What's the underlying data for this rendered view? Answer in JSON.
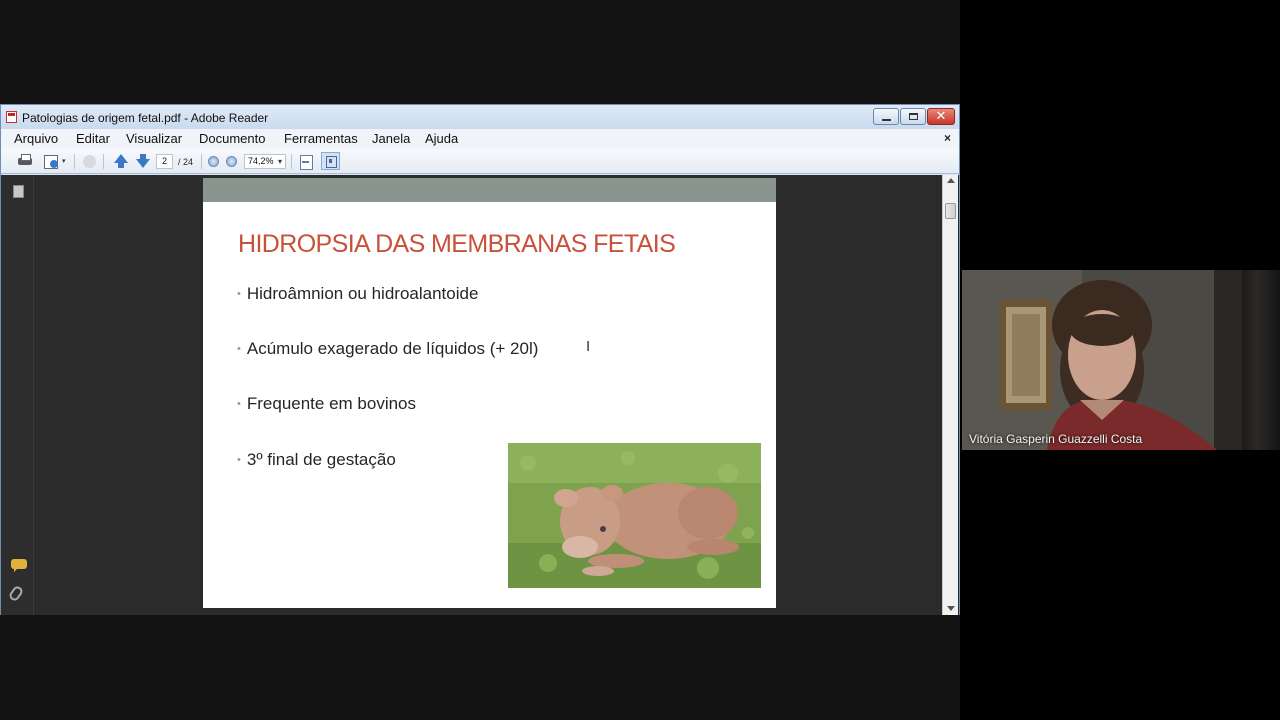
{
  "window": {
    "title": "Patologias de origem fetal.pdf - Adobe Reader"
  },
  "menubar": {
    "items": [
      "Arquivo",
      "Editar",
      "Visualizar",
      "Documento",
      "Ferramentas",
      "Janela",
      "Ajuda"
    ],
    "close_doc": "×"
  },
  "toolbar": {
    "page_current": "2",
    "page_total": "/ 24",
    "zoom": "74,2%"
  },
  "slide": {
    "title": "HIDROPSIA DAS MEMBRANAS FETAIS",
    "title_color": "#c9503a",
    "bullets": [
      "Hidroâmnion ou hidroalantoide",
      "Acúmulo exagerado de líquidos (+ 20l)",
      "Frequente em bovinos",
      "3º final de gestação"
    ],
    "image_icon": "calf-lying-on-grass"
  },
  "participant": {
    "name": "Vitória Gasperin Guazzelli Costa"
  }
}
